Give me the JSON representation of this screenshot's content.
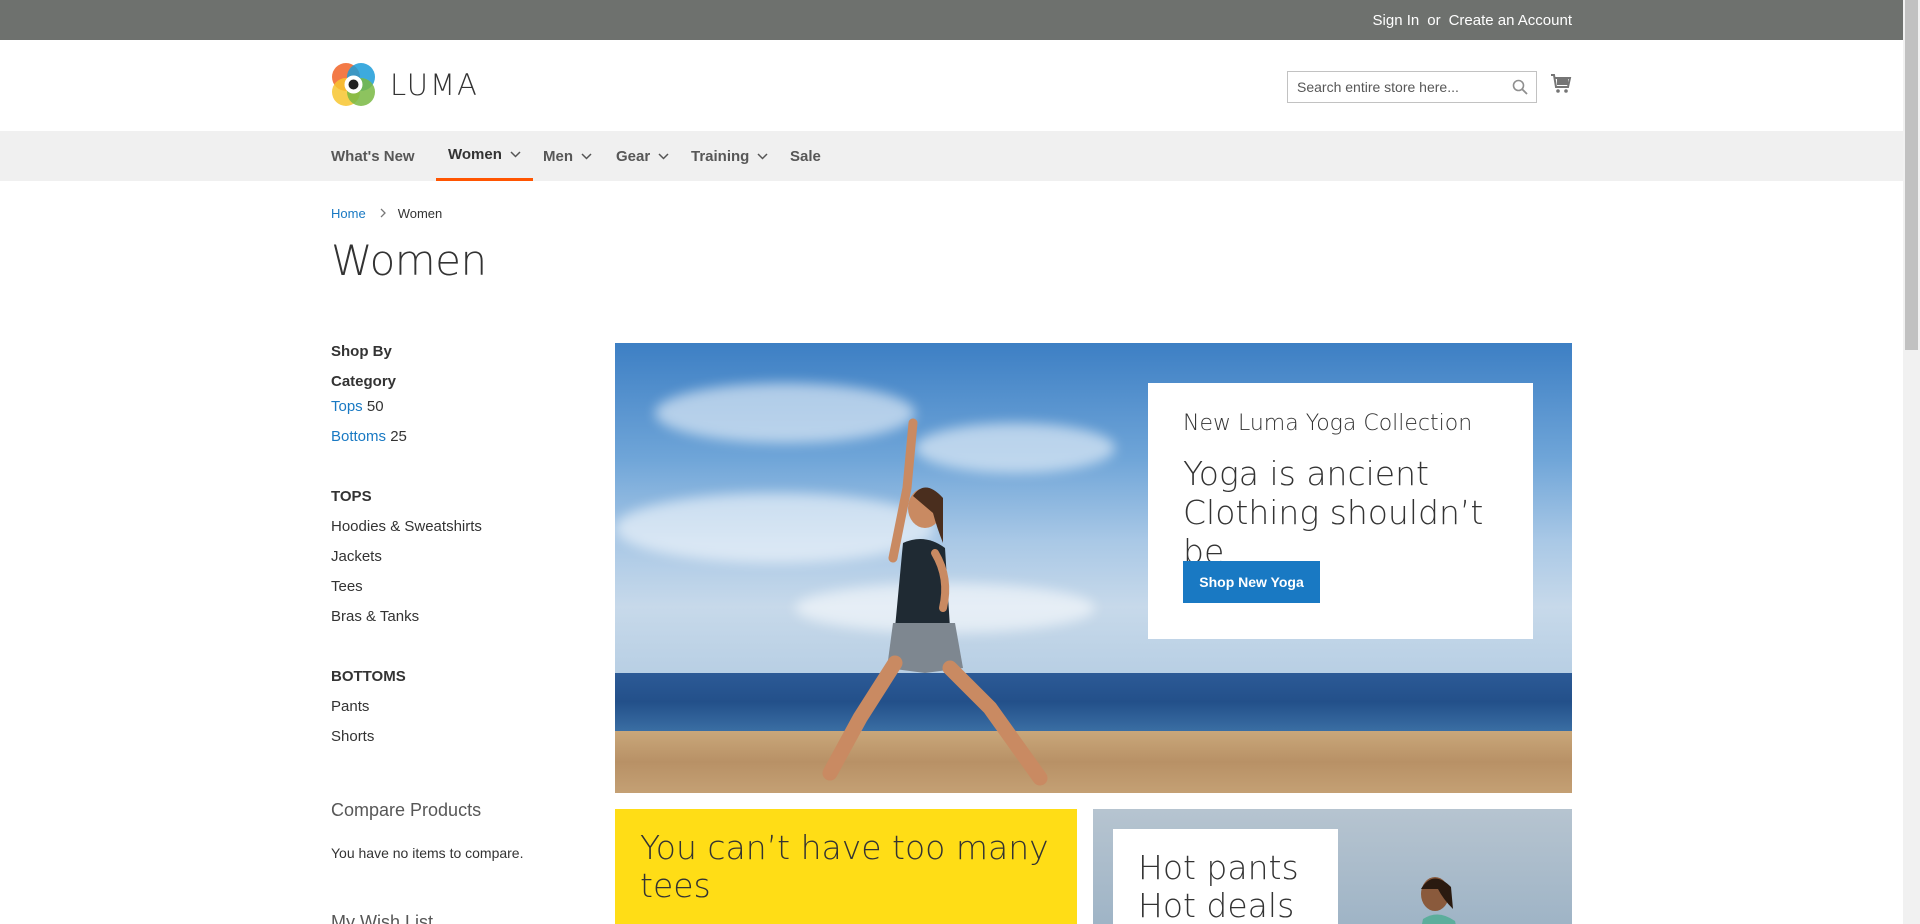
{
  "topbar": {
    "sign_in": "Sign In",
    "or": "or",
    "create_account": "Create an Account"
  },
  "header": {
    "logo_text": "LUMA",
    "search_placeholder": "Search entire store here...",
    "colors": {
      "accent": "#ff5501",
      "link": "#1979c3",
      "button": "#1979c3"
    }
  },
  "nav": {
    "items": [
      {
        "label": "What's New",
        "dropdown": false
      },
      {
        "label": "Women",
        "dropdown": true,
        "active": true
      },
      {
        "label": "Men",
        "dropdown": true
      },
      {
        "label": "Gear",
        "dropdown": true
      },
      {
        "label": "Training",
        "dropdown": true
      },
      {
        "label": "Sale",
        "dropdown": false
      }
    ]
  },
  "breadcrumb": {
    "home": "Home",
    "current": "Women"
  },
  "page": {
    "title": "Women"
  },
  "sidebar": {
    "shop_by": "Shop By",
    "category_heading": "Category",
    "categories": [
      {
        "label": "Tops",
        "count": "50"
      },
      {
        "label": "Bottoms",
        "count": "25"
      }
    ],
    "tops_heading": "TOPS",
    "tops_items": [
      "Hoodies & Sweatshirts",
      "Jackets",
      "Tees",
      "Bras & Tanks"
    ],
    "bottoms_heading": "BOTTOMS",
    "bottoms_items": [
      "Pants",
      "Shorts"
    ],
    "compare_title": "Compare Products",
    "compare_empty": "You have no items to compare.",
    "wishlist_title": "My Wish List"
  },
  "hero": {
    "subtitle": "New Luma Yoga Collection",
    "title_line1": "Yoga is ancient",
    "title_line2": "Clothing shouldn’t be",
    "button": "Shop New Yoga"
  },
  "promos": {
    "yellow": "You can’t have too many tees",
    "blue_line1": "Hot pants",
    "blue_line2": "Hot deals"
  }
}
